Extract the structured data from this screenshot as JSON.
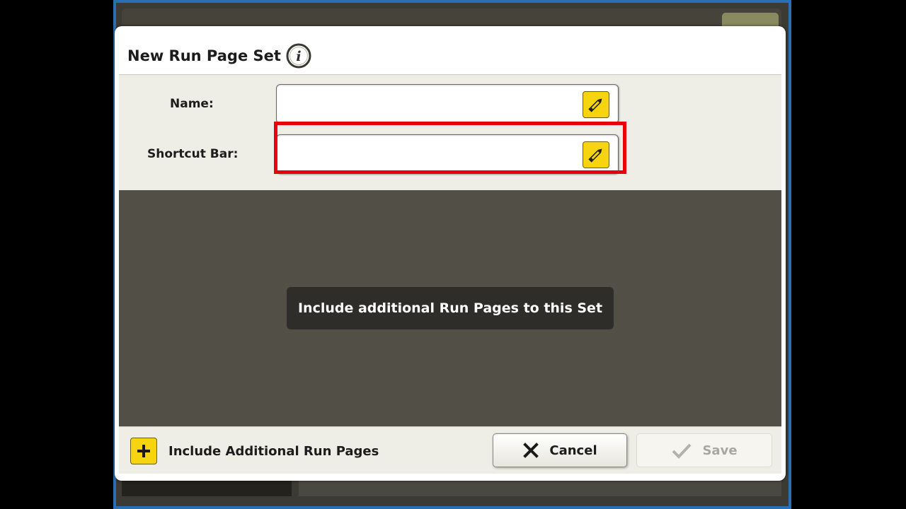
{
  "dialog": {
    "title": "New Run Page Set",
    "info_icon": "info-icon"
  },
  "form": {
    "name": {
      "label": "Name:",
      "value": "",
      "edit_icon": "pencil-icon"
    },
    "shortcut_bar": {
      "label": "Shortcut Bar:",
      "value": "",
      "edit_icon": "pencil-icon"
    }
  },
  "content": {
    "empty_message": "Include additional Run Pages to this Set"
  },
  "footer": {
    "include_label": "Include Additional Run Pages",
    "include_icon": "plus-icon",
    "cancel_label": "Cancel",
    "cancel_icon": "x-icon",
    "save_label": "Save",
    "save_icon": "check-icon",
    "save_enabled": false
  },
  "colors": {
    "accent_yellow": "#f6d40f",
    "highlight_red": "#e8000b",
    "content_bg": "#524f47",
    "form_bg": "#efeee6"
  }
}
